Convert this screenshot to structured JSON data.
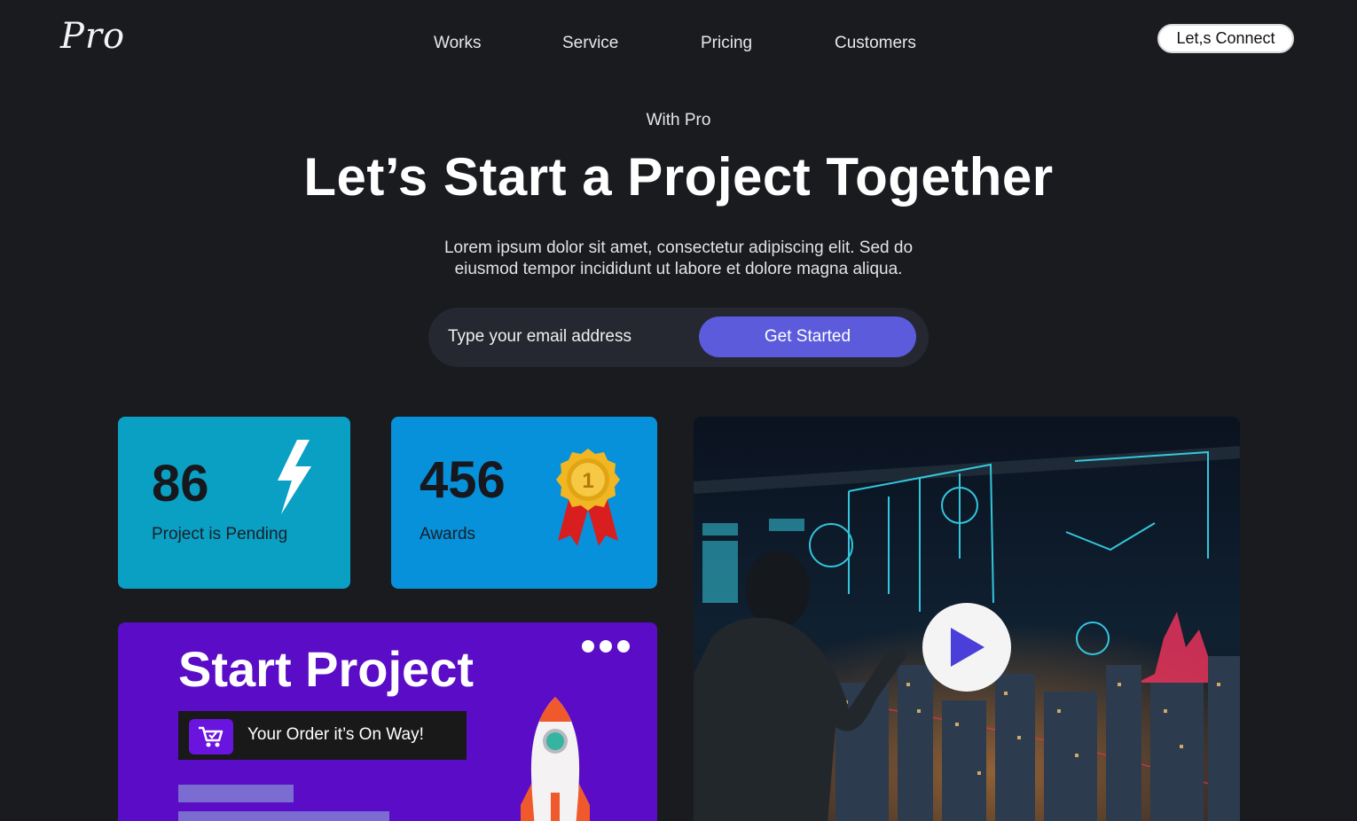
{
  "nav": {
    "logo": "Pro",
    "links": [
      "Works",
      "Service",
      "Pricing",
      "Customers"
    ],
    "cta": "Let,s Connect"
  },
  "hero": {
    "eyebrow": "With Pro",
    "title": "Let’s Start a Project Together",
    "description": "Lorem ipsum dolor sit amet, consectetur adipiscing elit. Sed do eiusmod tempor incididunt ut labore et dolore magna aliqua.",
    "email_placeholder": "Type your email address",
    "button": "Get Started"
  },
  "stats": {
    "pending": {
      "value": "86",
      "label": "Project is Pending",
      "icon": "lightning-bolt-icon",
      "color": "#0aa0c4"
    },
    "awards": {
      "value": "456",
      "label": "Awards",
      "icon": "gold-medal-icon",
      "color": "#0791da"
    }
  },
  "project": {
    "title": "Start Project",
    "order_text": "Your Order it’s On Way!",
    "order_icon": "shopping-cart-check-icon",
    "color": "#5a0cc6"
  },
  "video": {
    "icon": "play-icon",
    "accent": "#4a3fd8"
  },
  "colors": {
    "background": "#191b1f",
    "primary_button": "#5b5bdc"
  }
}
